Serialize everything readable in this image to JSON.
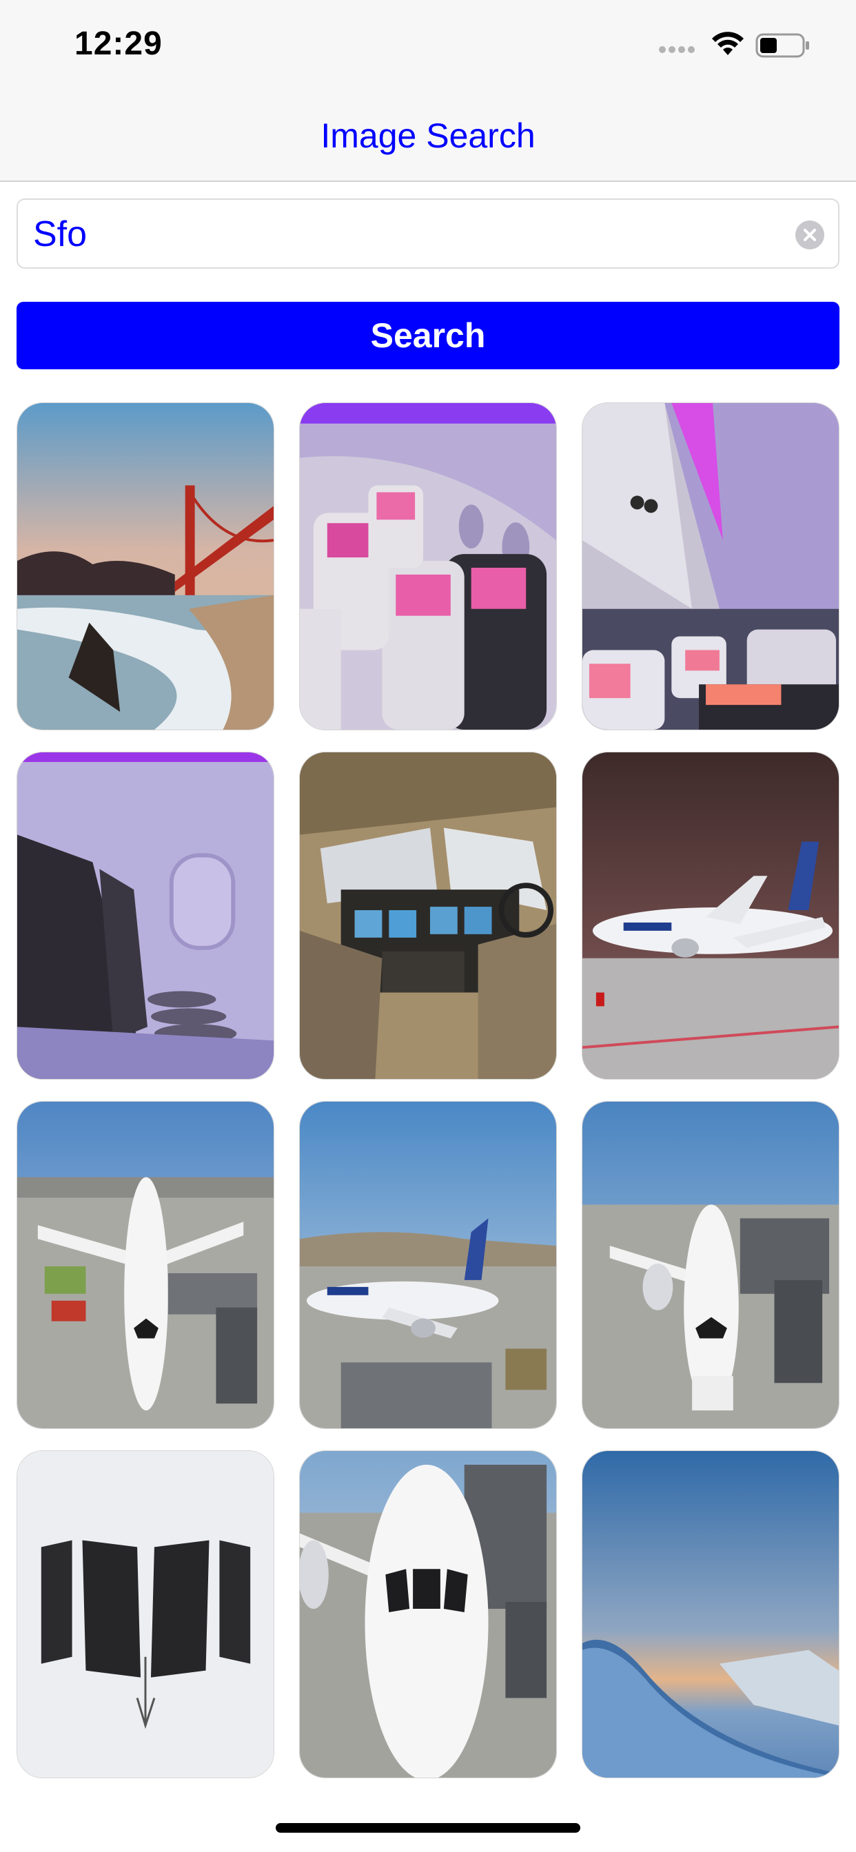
{
  "status_bar": {
    "time": "12:29"
  },
  "nav": {
    "title": "Image Search"
  },
  "search": {
    "value": "Sfo"
  },
  "search_button": {
    "label": "Search"
  },
  "results": [
    {
      "name": "golden-gate-beach-photo"
    },
    {
      "name": "cabin-seats-screens-photo"
    },
    {
      "name": "cabin-aisle-purple-photo"
    },
    {
      "name": "cabin-window-seat-photo"
    },
    {
      "name": "cockpit-photo"
    },
    {
      "name": "united-plane-night-photo"
    },
    {
      "name": "plane-at-gate-photo"
    },
    {
      "name": "united-plane-taxiing-photo"
    },
    {
      "name": "plane-front-gate-photo"
    },
    {
      "name": "cockpit-windows-closeup-photo"
    },
    {
      "name": "plane-nose-gate-photo"
    },
    {
      "name": "wing-sunset-photo"
    }
  ],
  "colors": {
    "accent": "#0000ff",
    "nav_background": "#f7f7f7"
  }
}
